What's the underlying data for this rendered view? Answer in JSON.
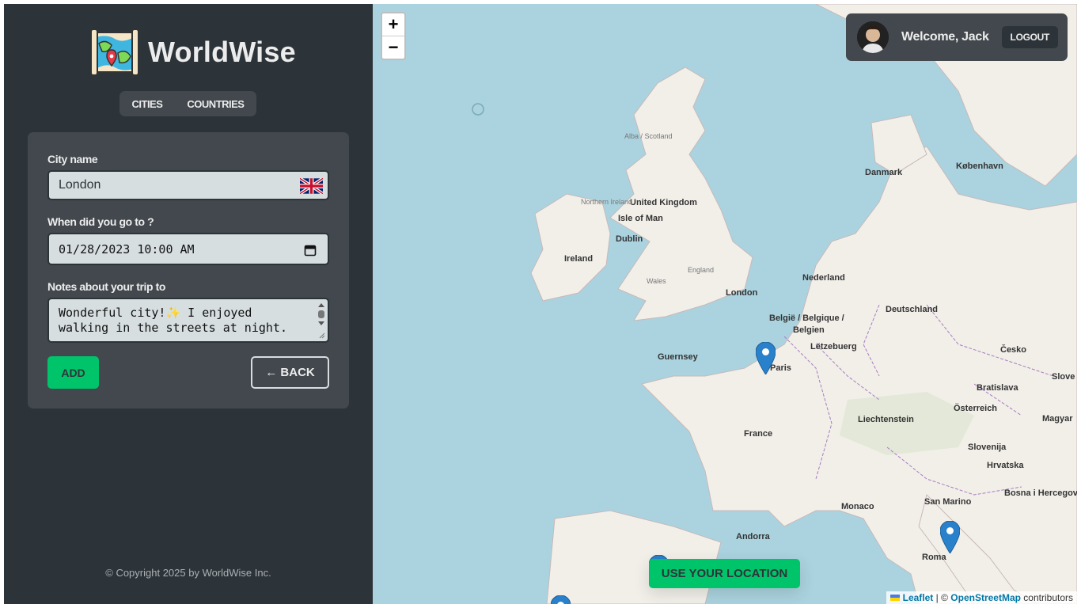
{
  "app": {
    "name": "WorldWise"
  },
  "nav": {
    "cities": "CITIES",
    "countries": "COUNTRIES"
  },
  "form": {
    "city_label": "City name",
    "city_value": "London",
    "date_label": "When did you go to ?",
    "date_value": "01/28/2023 10:00 AM",
    "notes_label": "Notes about your trip to",
    "notes_value": "Wonderful city!✨ I enjoyed walking in the streets at night.",
    "add_label": "ADD",
    "back_label": "← BACK"
  },
  "footer": {
    "copyright": "© Copyright 2025 by WorldWise Inc."
  },
  "user": {
    "welcome": "Welcome, Jack",
    "logout": "LOGOUT"
  },
  "map": {
    "zoom_in": "+",
    "zoom_out": "−",
    "use_location": "USE YOUR LOCATION",
    "attribution": {
      "leaflet": "Leaflet",
      "sep": " | © ",
      "osm": "OpenStreetMap",
      "suffix": " contributors"
    },
    "labels": {
      "alba": "Alba / Scotland",
      "uk": "United Kingdom",
      "iom": "Isle of Man",
      "ni": "Northern Ireland",
      "dublin": "Dublin",
      "ireland": "Ireland",
      "wales": "Wales",
      "england": "England",
      "london": "London",
      "danmark": "Danmark",
      "kobenhavn": "København",
      "nederland": "Nederland",
      "deutschland": "Deutschland",
      "belgie": "België / Belgique /",
      "belgien": "Belgien",
      "letzebuerg": "Lëtzebuerg",
      "guernsey": "Guernsey",
      "paris": "Paris",
      "cesko": "Česko",
      "bratislava": "Bratislava",
      "osterreich": "Österreich",
      "liechtenstein": "Liechtenstein",
      "france": "France",
      "slovenija": "Slovenija",
      "hrvatska": "Hrvatska",
      "sanmarino": "San Marino",
      "monaco": "Monaco",
      "bosna": "Bosna i Hercegovina",
      "andorra": "Andorra",
      "roma": "Roma",
      "magyar": "Magyar",
      "slove": "Slove"
    }
  },
  "colors": {
    "sidebar": "#2d3439",
    "panel": "#42484d",
    "brand": "#00c46a",
    "sea": "#aad3df",
    "land": "#f2efe9",
    "marker": "#2a81cb"
  }
}
